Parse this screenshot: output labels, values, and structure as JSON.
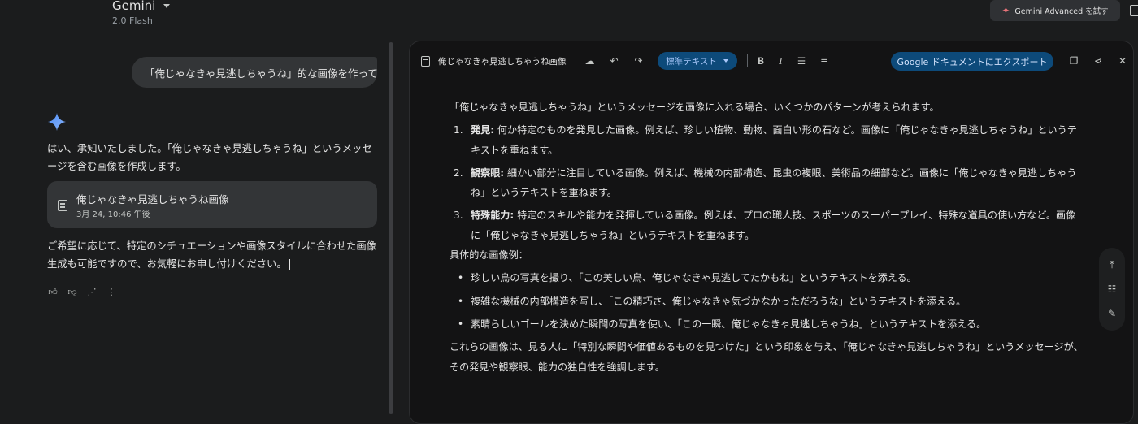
{
  "app": {
    "title": "Gemini",
    "model": "2.0 Flash",
    "advanced_btn": "Gemini Advanced を試す"
  },
  "chat": {
    "user_message": "「俺じゃなきゃ見逃しちゃうね」的な画像を作って",
    "reply_intro": "はい、承知いたしました。「俺じゃなきゃ見逃しちゃうね」というメッセージを含む画像を作成します。",
    "doc_card": {
      "title": "俺じゃなきゃ見逃しちゃうね画像",
      "date": "3月 24, 10:46 午後"
    },
    "reply_outro": "ご希望に応じて、特定のシチュエーションや画像スタイルに合わせた画像生成も可能ですので、お気軽にお申し付けください。"
  },
  "doc": {
    "title": "俺じゃなきゃ見逃しちゃうね画像",
    "style": "標準テキスト",
    "export_label": "Google ドキュメントにエクスポート",
    "intro": "「俺じゃなきゃ見逃しちゃうね」というメッセージを画像に入れる場合、いくつかのパターンが考えられます。",
    "numbered": [
      {
        "num": "1.",
        "label": "発見:",
        "text": " 何か特定のものを発見した画像。例えば、珍しい植物、動物、面白い形の石など。画像に「俺じゃなきゃ見逃しちゃうね」というテキストを重ねます。"
      },
      {
        "num": "2.",
        "label": "観察眼:",
        "text": " 細かい部分に注目している画像。例えば、機械の内部構造、昆虫の複眼、美術品の細部など。画像に「俺じゃなきゃ見逃しちゃうね」というテキストを重ねます。"
      },
      {
        "num": "3.",
        "label": "特殊能力:",
        "text": " 特定のスキルや能力を発揮している画像。例えば、プロの職人技、スポーツのスーパープレイ、特殊な道具の使い方など。画像に「俺じゃなきゃ見逃しちゃうね」というテキストを重ねます。"
      }
    ],
    "examples_heading": "具体的な画像例：",
    "bullets": [
      "珍しい鳥の写真を撮り、「この美しい鳥、俺じゃなきゃ見逃してたかもね」というテキストを添える。",
      "複雑な機械の内部構造を写し、「この精巧さ、俺じゃなきゃ気づかなかっただろうな」というテキストを添える。",
      "素晴らしいゴールを決めた瞬間の写真を使い、「この一瞬、俺じゃなきゃ見逃しちゃうね」というテキストを添える。"
    ],
    "conclusion": "これらの画像は、見る人に「特別な瞬間や価値あるものを見つけた」という印象を与え、「俺じゃなきゃ見逃しちゃうね」というメッセージが、その発見や観察眼、能力の独自性を強調します。"
  }
}
